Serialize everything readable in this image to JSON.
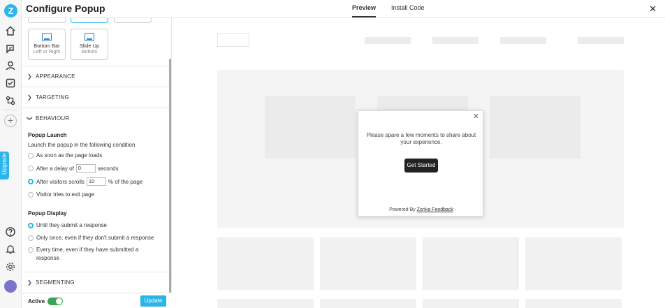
{
  "rail": {
    "logo_letter": "Z",
    "icons": [
      "home-icon",
      "chat-icon",
      "user-icon",
      "checklist-icon",
      "integrations-icon",
      "add-icon",
      "help-icon",
      "notification-icon",
      "gear-icon",
      "avatar"
    ],
    "upgrade_label": "Upgrade"
  },
  "header": {
    "title": "Configure Popup",
    "tabs": [
      {
        "label": "Preview",
        "active": true
      },
      {
        "label": "Install Code",
        "active": false
      }
    ],
    "close": "✕"
  },
  "panel": {
    "layout_cards": [
      {
        "name": "Bottom Bar",
        "sub": "Left or Right"
      },
      {
        "name": "Slide Up",
        "sub": "Bottom"
      }
    ],
    "sections": {
      "appearance": "APPEARANCE",
      "targeting": "TARGETING",
      "behaviour": "BEHAVIOUR",
      "segmenting": "SEGMENTING"
    },
    "behaviour": {
      "launch_title": "Popup Launch",
      "launch_desc": "Launch the popup in the following condition",
      "opt_page_loads": "As soon as the page loads",
      "opt_delay_prefix": "After a delay of",
      "delay_value": "0",
      "opt_delay_suffix": "seconds",
      "opt_scroll_prefix": "After visitors scrolls",
      "scroll_value": "10",
      "opt_scroll_suffix": "% of the page",
      "opt_exit": "Visitor tries to exit page",
      "selected_launch": "scroll",
      "display_title": "Popup Display",
      "opt_until_submit": "Until they submit a response",
      "opt_only_once": "Only once, even if they don't submit a response",
      "opt_every_time_1": "Every time, even if they have submitted a",
      "opt_every_time_2": "response",
      "selected_display": "until_submit"
    }
  },
  "footer": {
    "active_label": "Active",
    "active_on": true,
    "update_label": "Update"
  },
  "popup": {
    "message": "Please spare a few moments to share about your experience.",
    "button": "Get Started",
    "powered_prefix": "Powered By",
    "powered_link": "Zonka Feedback",
    "close": "✕"
  },
  "colors": {
    "accent": "#2bb6ea",
    "toggle_on": "#3aa655",
    "avatar": "#7a73c9"
  }
}
